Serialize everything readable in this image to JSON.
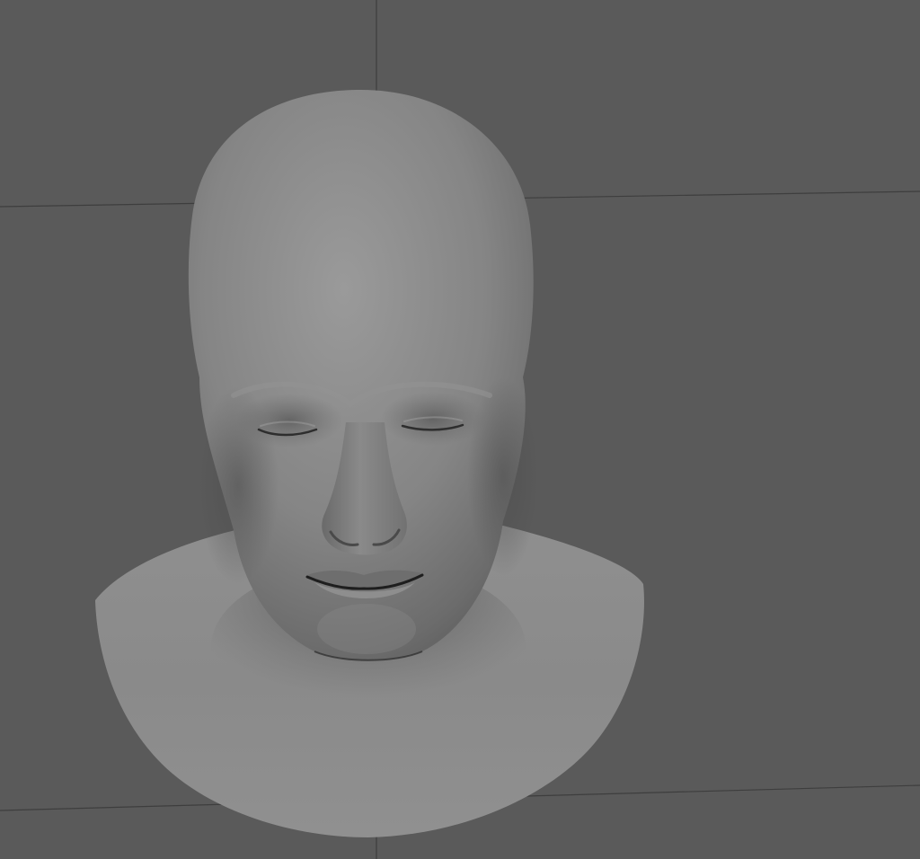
{
  "viewport": {
    "background_color": "#5a5a5a",
    "grid_line_color": "#3e3e3e",
    "grid_visible": true,
    "shading": "smooth-shaded",
    "material_base_color": "#8c8c8c"
  },
  "model": {
    "type": "human head bust",
    "state": "eyes closed, mouth closed"
  }
}
